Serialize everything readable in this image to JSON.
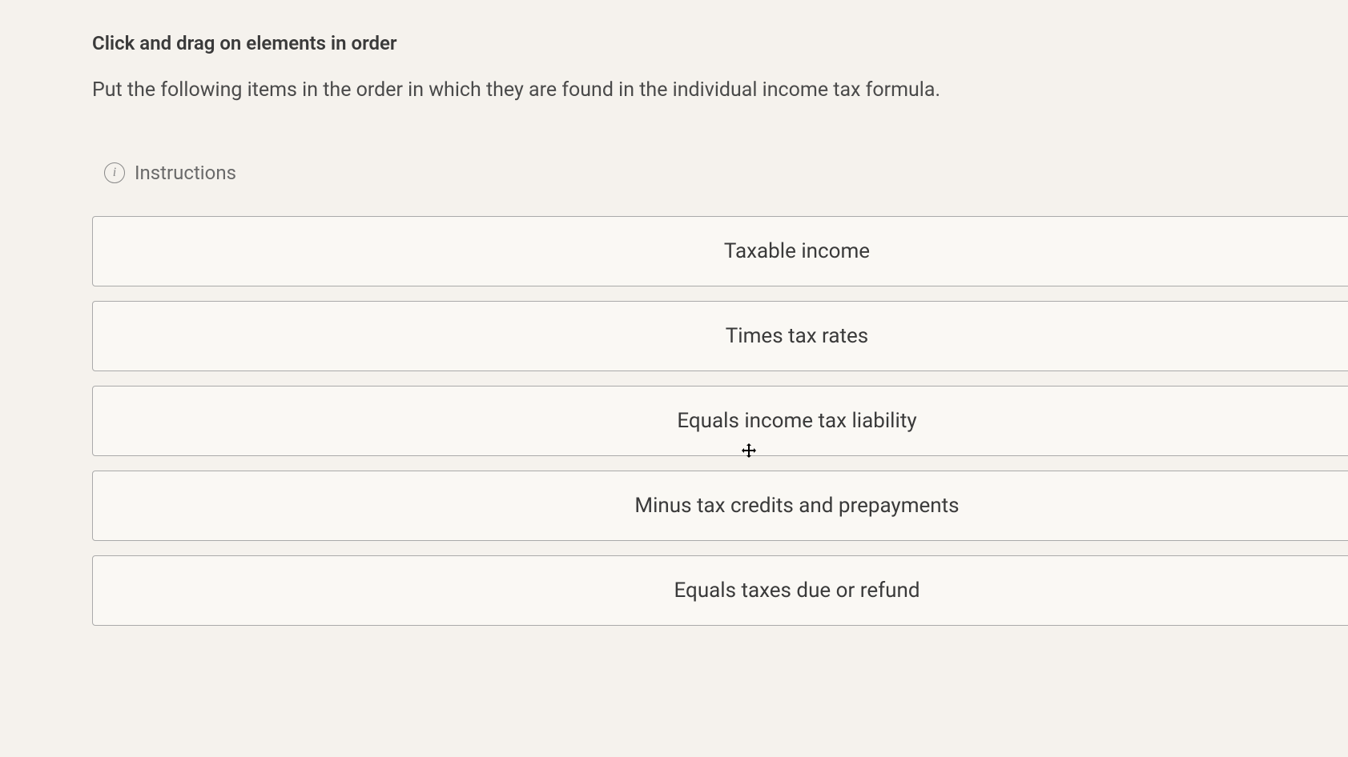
{
  "header": {
    "title": "Click and drag on elements in order",
    "prompt": "Put the following items in the order in which they are found in the individual income tax formula."
  },
  "instructions": {
    "label": "Instructions"
  },
  "items": [
    {
      "label": "Taxable income"
    },
    {
      "label": "Times tax rates"
    },
    {
      "label": "Equals income tax liability"
    },
    {
      "label": "Minus tax credits and prepayments"
    },
    {
      "label": "Equals taxes due or refund"
    }
  ]
}
